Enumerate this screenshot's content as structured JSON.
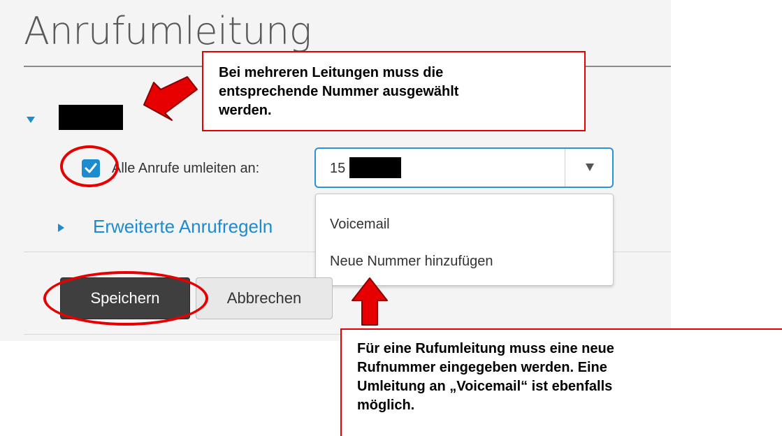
{
  "page": {
    "title": "Anrufumleitung"
  },
  "forwarding": {
    "checkbox_checked": true,
    "label": "Alle Anrufe umleiten an:",
    "number_visible_prefix": "15",
    "dropdown_options": [
      "Voicemail",
      "Neue Nummer hinzufügen"
    ]
  },
  "advanced": {
    "label": "Erweiterte Anrufregeln"
  },
  "buttons": {
    "save": "Speichern",
    "cancel": "Abbrechen"
  },
  "annotations": {
    "top_callout": [
      "Bei mehreren Leitungen muss die",
      "entsprechende Nummer ausgewählt",
      "werden."
    ],
    "bottom_callout": [
      "Für eine Rufumleitung muss eine neue",
      "Rufnummer eingegeben werden. Eine",
      "Umleitung an „Voicemail“ ist ebenfalls",
      "möglich."
    ]
  },
  "colors": {
    "accent": "#1c8bd0",
    "annotation_red": "#e60000",
    "save_button": "#3f3f3f"
  }
}
